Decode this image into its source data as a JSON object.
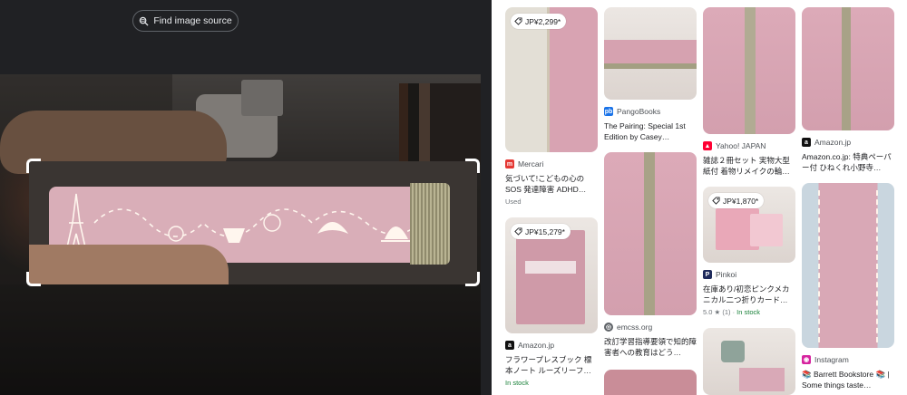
{
  "lens": {
    "find_source_label": "Find image source"
  },
  "results": [
    {
      "id": "r1",
      "price": "JP¥2,299*",
      "source": "Mercari",
      "title": "気づいて!こどもの心の SOS 発達障害 ADHD…",
      "meta": "Used"
    },
    {
      "id": "r2",
      "source": "PangoBooks",
      "title": "The Pairing: Special 1st Edition by Casey…"
    },
    {
      "id": "r3",
      "source": "Yahoo! JAPAN",
      "title": "雑誌２冊セット 実物大型 紙付 着物リメイクの輪…"
    },
    {
      "id": "r4",
      "source": "Amazon.jp",
      "title": "Amazon.co.jp: 特典ペーパー付 ひねくれ小野寺…"
    },
    {
      "id": "r5",
      "price": "JP¥15,279*",
      "source": "Amazon.jp",
      "title": "フラワープレスブック 標本ノート ルーズリーフ…",
      "stock": "In stock"
    },
    {
      "id": "r6",
      "source": "emcss.org",
      "title": "改訂学習指導要領で知的障害者への教育はどう…"
    },
    {
      "id": "r7",
      "price": "JP¥1,870*",
      "source": "Pinkoi",
      "title": "在庫あり/初恋ピンクメカニカル二つ折りカード…",
      "rating": "5.0 ★ (1)",
      "stock": "In stock"
    },
    {
      "id": "r8",
      "source": "Instagram",
      "title": "📚 Barrett Bookstore 📚 | Some things taste…"
    }
  ],
  "colors": {
    "lens_bg": "#202124",
    "book_pink": "#d9aeb8",
    "in_stock_green": "#188038",
    "mercari_red": "#e53935",
    "pango_blue": "#1a73e8",
    "yahoo_red": "#ff0033",
    "amazon_black": "#111111",
    "pinkoi_navy": "#1f2b5c",
    "instagram_pink": "#d6249f"
  }
}
